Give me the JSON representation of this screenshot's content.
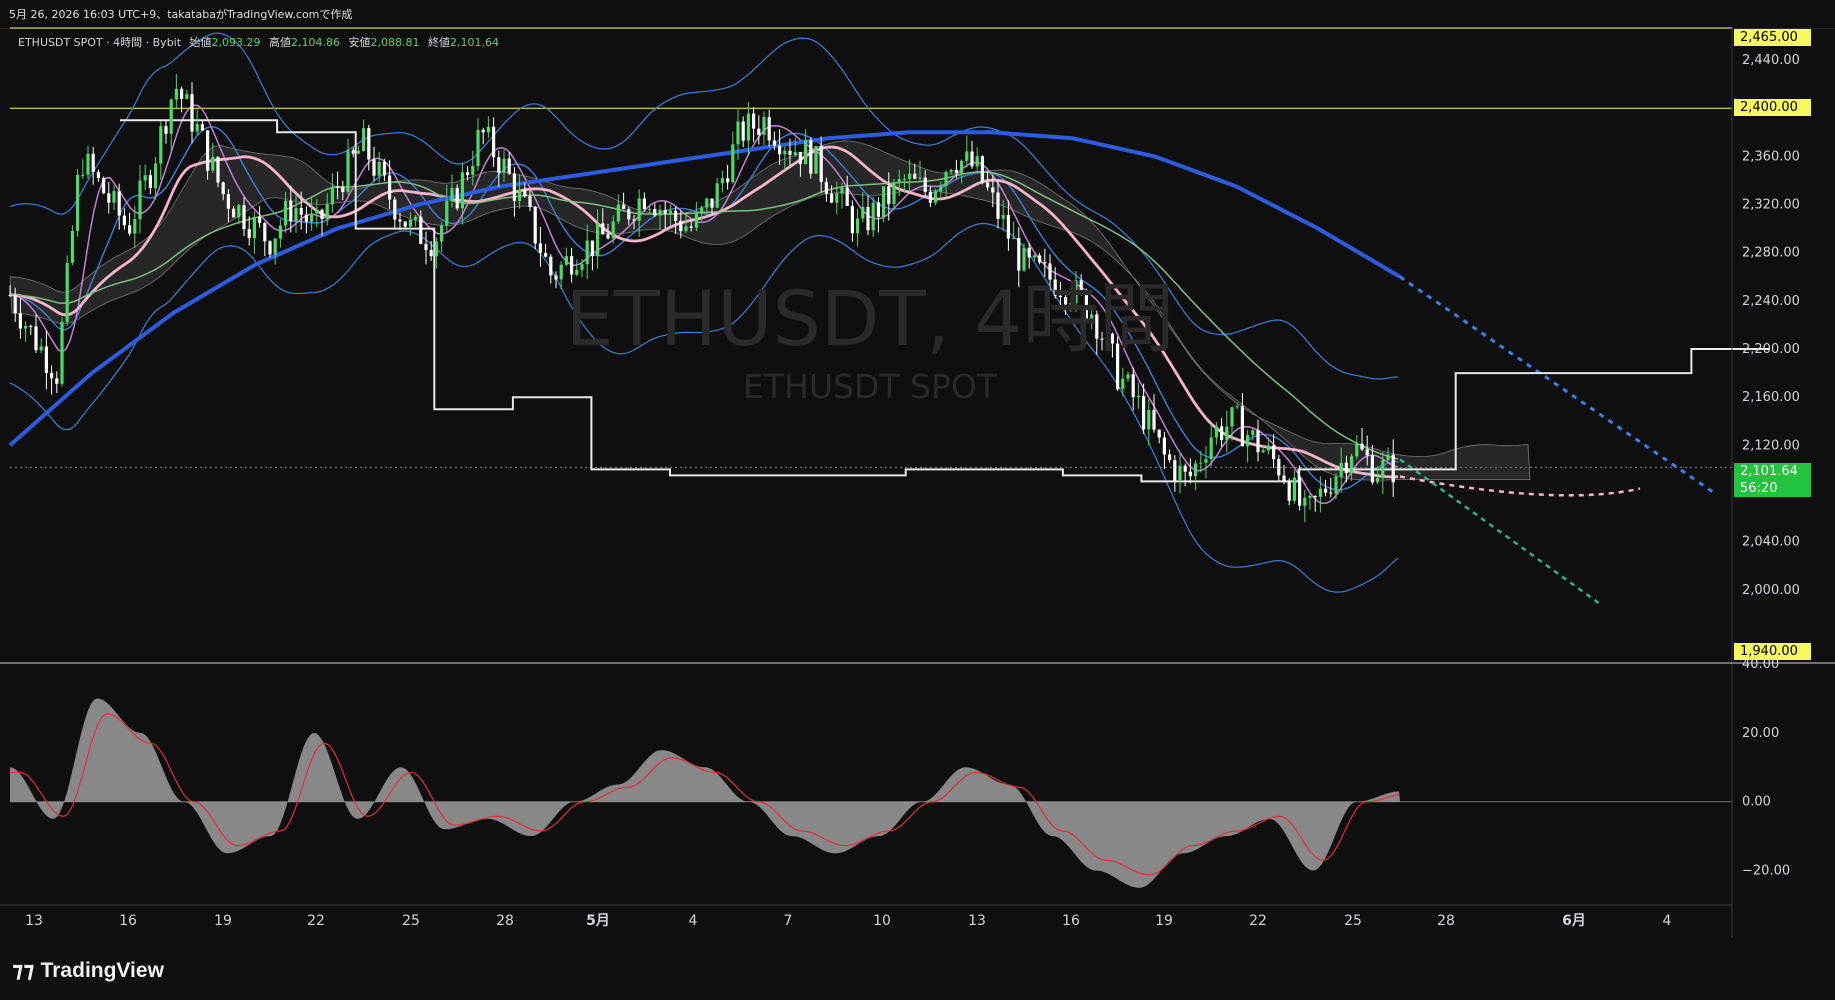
{
  "header": {
    "created_text": "5月 26, 2026 16:03 UTC+9、takatabaがTradingView.comで作成"
  },
  "legend": {
    "symbol": "ETHUSDT SPOT · 4時間 · Bybit",
    "open_label": "始値",
    "open": "2,093.29",
    "high_label": "高値",
    "high": "2,104.86",
    "low_label": "安値",
    "low": "2,088.81",
    "close_label": "終値",
    "close": "2,101.64"
  },
  "watermark": {
    "main": "ETHUSDT, 4時間",
    "sub": "ETHUSDT SPOT"
  },
  "price_labels": {
    "top": "2,465.00",
    "level": "2,400.00",
    "last": "2,101.64",
    "countdown": "56:20",
    "bottom": "1,940.00"
  },
  "brand": {
    "name": "TradingView"
  },
  "colors": {
    "background": "#0f0f0f",
    "up_candle": "#4cd964",
    "down_candle": "#ffffff",
    "bollinger": "#3d7fd8",
    "ma_fast": "#c37fd6",
    "ma_pink": "#f5b3cc",
    "ma_green": "#7fbf7f",
    "ma_blue": "#2c5ce0",
    "ichimoku_line": "#e8e8e8",
    "cloud": "#555555",
    "osc_fill": "#9e9e9e",
    "osc_signal": "#e0303a",
    "yellow_line": "#f7f75e"
  },
  "chart_data": [
    {
      "type": "line",
      "panel": "price",
      "title": "",
      "ylim": [
        1940,
        2465
      ],
      "y_ticks": [
        2000,
        2040,
        2080,
        2120,
        2160,
        2200,
        2240,
        2280,
        2320,
        2360,
        2400,
        2440
      ],
      "y_tick_labels": [
        "2,000.00",
        "2,040.00",
        "",
        "2,120.00",
        "2,160.00",
        "2,200.00",
        "2,240.00",
        "2,280.00",
        "2,320.00",
        "2,360.00",
        "",
        "2,440.00"
      ],
      "x_tick_labels": [
        "13",
        "16",
        "19",
        "22",
        "25",
        "28",
        "5月",
        "4",
        "7",
        "10",
        "13",
        "16",
        "19",
        "22",
        "25",
        "28",
        "6月",
        "4"
      ],
      "horizontal_levels": [
        2400
      ],
      "last_price": 2101.64,
      "series": [
        {
          "role": "close_path",
          "values": [
            2245,
            2210,
            2180,
            2360,
            2330,
            2300,
            2350,
            2420,
            2380,
            2330,
            2310,
            2290,
            2320,
            2300,
            2340,
            2370,
            2330,
            2300,
            2290,
            2330,
            2380,
            2350,
            2310,
            2260,
            2280,
            2290,
            2310,
            2330,
            2310,
            2300,
            2330,
            2380,
            2390,
            2370,
            2360,
            2330,
            2300,
            2320,
            2340,
            2330,
            2360,
            2350,
            2310,
            2270,
            2260,
            2250,
            2230,
            2180,
            2150,
            2110,
            2090,
            2130,
            2140,
            2120,
            2100,
            2060,
            2090,
            2120,
            2100,
            2101.64
          ]
        },
        {
          "role": "ma_blue",
          "values": [
            2120,
            2180,
            2230,
            2270,
            2300,
            2320,
            2335,
            2345,
            2355,
            2365,
            2375,
            2380,
            2380,
            2375,
            2360,
            2335,
            2300,
            2260
          ]
        },
        {
          "role": "ichimoku_white",
          "values": [
            2390,
            2390,
            2380,
            2300,
            2150,
            2160,
            2100,
            2095,
            2095,
            2095,
            2100,
            2100,
            2095,
            2090,
            2090,
            2100,
            2100,
            2180,
            2180,
            2180,
            2200,
            2200
          ]
        },
        {
          "role": "oscillator",
          "values": [
            10,
            -5,
            30,
            20,
            0,
            -15,
            -10,
            20,
            -5,
            10,
            -8,
            -5,
            -10,
            0,
            5,
            15,
            10,
            0,
            -10,
            -15,
            -10,
            0,
            10,
            5,
            -10,
            -20,
            -25,
            -15,
            -10,
            -5,
            -20,
            0,
            3
          ]
        }
      ]
    },
    {
      "type": "area",
      "panel": "oscillator",
      "ylim": [
        -30,
        40
      ],
      "y_ticks": [
        -20,
        0,
        20,
        40
      ],
      "y_tick_labels": [
        "−20.00",
        "0.00",
        "20.00",
        "40.00"
      ]
    }
  ]
}
